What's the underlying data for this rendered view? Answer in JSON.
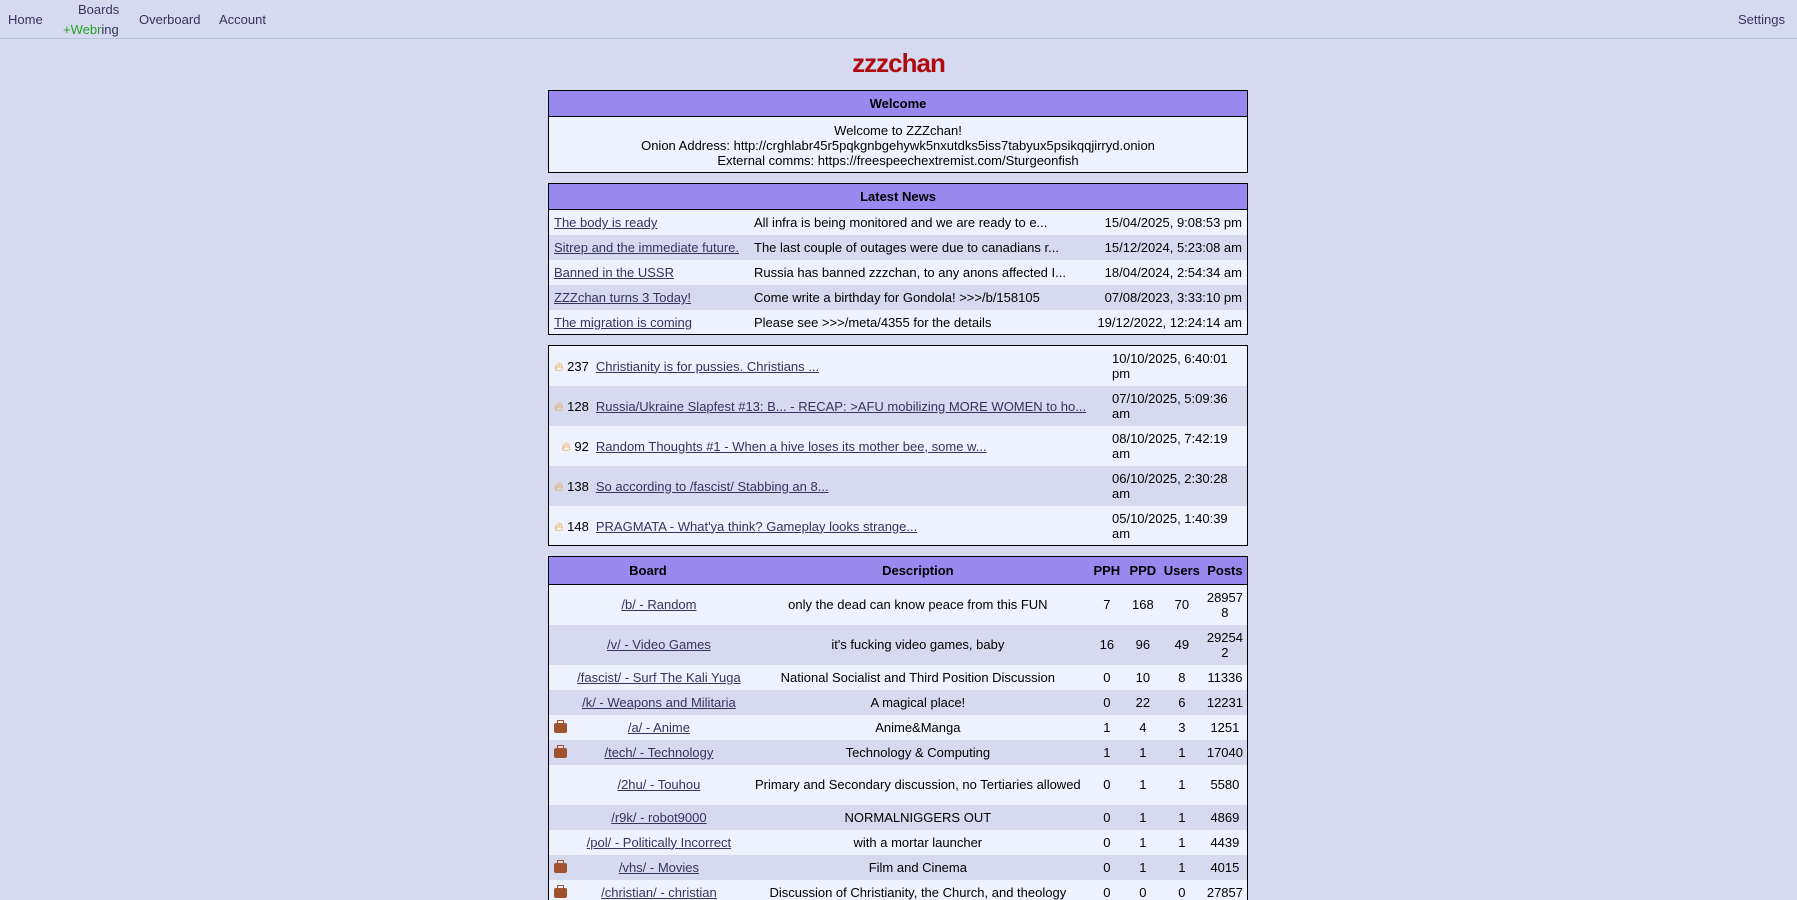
{
  "nav": {
    "home": "Home",
    "boards": "Boards",
    "webring_plus": "+Webr",
    "webring_suffix": "ing",
    "overboard": "Overboard",
    "account": "Account",
    "settings": "Settings"
  },
  "site_title": "zzzchan",
  "welcome": {
    "heading": "Welcome",
    "lines": [
      "Welcome to ZZZchan!",
      "Onion Address: http://crghlabr45r5pqkgnbgehywk5nxutdks5iss7tabyux5psikqqjirryd.onion",
      "External comms: https://freespeechextremist.com/Sturgeonfish"
    ]
  },
  "news": {
    "heading": "Latest News",
    "items": [
      {
        "title": "The body is ready",
        "excerpt": "All infra is being monitored and we are ready to e...",
        "date": "15/04/2025, 9:08:53 pm"
      },
      {
        "title": "Sitrep and the immediate future.",
        "excerpt": "The last couple of outages were due to canadians r...",
        "date": "15/12/2024, 5:23:08 am"
      },
      {
        "title": "Banned in the USSR",
        "excerpt": "Russia has banned zzzchan, to any anons affected I...",
        "date": "18/04/2024, 2:54:34 am"
      },
      {
        "title": "ZZZchan turns 3 Today!",
        "excerpt": "Come write a birthday for Gondola! >>>/b/158105",
        "date": "07/08/2023, 3:33:10 pm"
      },
      {
        "title": "The migration is coming",
        "excerpt": "Please see >>>/meta/4355 for the details",
        "date": "19/12/2022, 12:24:14 am"
      }
    ]
  },
  "hot_threads": [
    {
      "count": "237",
      "title": "Christianity is for pussies. Christians ...",
      "date": "10/10/2025, 6:40:01 pm"
    },
    {
      "count": "128",
      "title": "Russia/Ukraine Slapfest #13: B... - RECAP: >AFU mobilizing MORE WOMEN to ho...",
      "date": "07/10/2025, 5:09:36 am"
    },
    {
      "count": "92",
      "title": "Random Thoughts #1 - When a hive loses its mother bee, some w...",
      "date": "08/10/2025, 7:42:19 am"
    },
    {
      "count": "138",
      "title": "So according to /fascist/ Stabbing an 8...",
      "date": "06/10/2025, 2:30:28 am"
    },
    {
      "count": "148",
      "title": "PRAGMATA - What'ya think? Gameplay looks strange...",
      "date": "05/10/2025, 1:40:39 am"
    }
  ],
  "boards_table": {
    "headers": {
      "board": "Board",
      "description": "Description",
      "pph": "PPH",
      "ppd": "PPD",
      "users": "Users",
      "posts": "Posts"
    },
    "rows": [
      {
        "icon": "",
        "board": "/b/ - Random",
        "description": "only the dead can know peace from this FUN",
        "pph": "7",
        "ppd": "168",
        "users": "70",
        "posts": "289578"
      },
      {
        "icon": "",
        "board": "/v/ - Video Games",
        "description": "it's fucking video games, baby",
        "pph": "16",
        "ppd": "96",
        "users": "49",
        "posts": "292542"
      },
      {
        "icon": "",
        "board": "/fascist/ - Surf The Kali Yuga",
        "description": "National Socialist and Third Position Discussion",
        "pph": "0",
        "ppd": "10",
        "users": "8",
        "posts": "11336"
      },
      {
        "icon": "",
        "board": "/k/ - Weapons and Militaria",
        "description": "A magical place!",
        "pph": "0",
        "ppd": "22",
        "users": "6",
        "posts": "12231"
      },
      {
        "icon": "briefcase-icon",
        "board": "/a/ - Anime",
        "description": "Anime&Manga",
        "pph": "1",
        "ppd": "4",
        "users": "3",
        "posts": "1251"
      },
      {
        "icon": "briefcase-icon",
        "board": "/tech/ - Technology",
        "description": "Technology & Computing",
        "pph": "1",
        "ppd": "1",
        "users": "1",
        "posts": "17040"
      },
      {
        "icon": "",
        "board": "/2hu/ - Touhou",
        "description": "Primary and Secondary discussion, no Tertiaries allowed",
        "pph": "0",
        "ppd": "1",
        "users": "1",
        "posts": "5580"
      },
      {
        "icon": "",
        "board": "/r9k/ - robot9000",
        "description": "NORMALNIGGERS OUT",
        "pph": "0",
        "ppd": "1",
        "users": "1",
        "posts": "4869"
      },
      {
        "icon": "",
        "board": "/pol/ - Politically Incorrect",
        "description": "with a mortar launcher",
        "pph": "0",
        "ppd": "1",
        "users": "1",
        "posts": "4439"
      },
      {
        "icon": "briefcase-icon",
        "board": "/vhs/ - Movies",
        "description": "Film and Cinema",
        "pph": "0",
        "ppd": "1",
        "users": "1",
        "posts": "4015"
      },
      {
        "icon": "briefcase-icon",
        "board": "/christian/ - christian",
        "description": "Discussion of Christianity, the Church, and theology",
        "pph": "0",
        "ppd": "0",
        "users": "0",
        "posts": "27857"
      }
    ]
  }
}
